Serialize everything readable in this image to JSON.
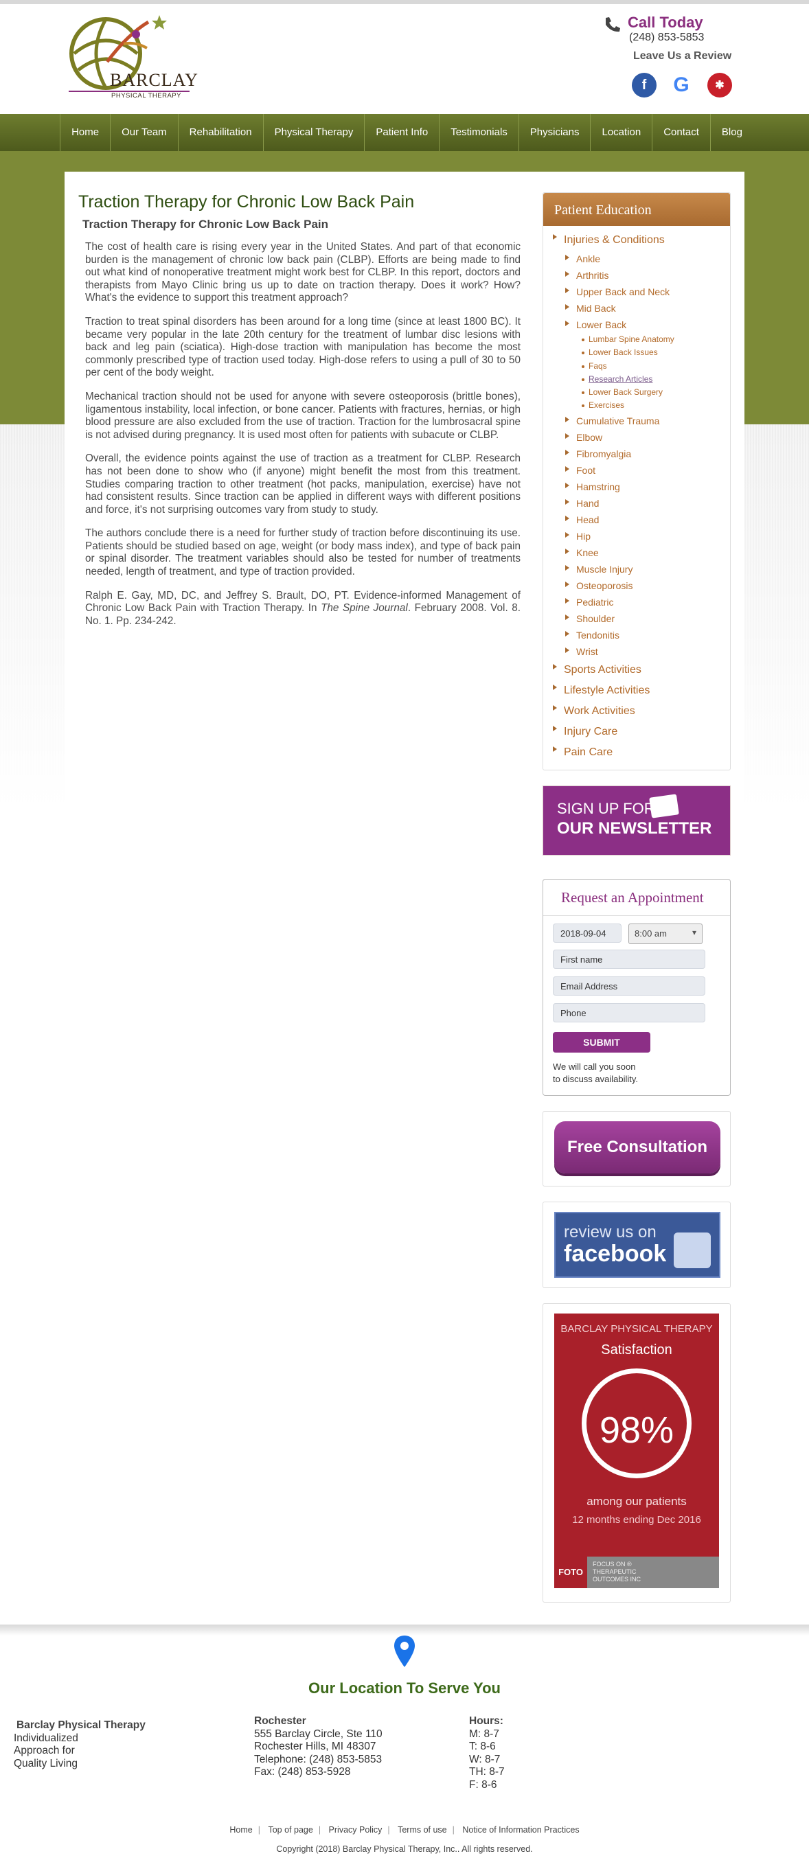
{
  "header": {
    "logo_name": "BARCLAY",
    "logo_sub": "PHYSICAL THERAPY",
    "call_title": "Call Today",
    "call_number": "(248) 853-5853",
    "review_text": "Leave Us a Review",
    "social_icons": [
      "facebook-icon",
      "google-icon",
      "yelp-icon"
    ]
  },
  "nav": [
    "Home",
    "Our Team",
    "Rehabilitation",
    "Physical Therapy",
    "Patient Info",
    "Testimonials",
    "Physicians",
    "Location",
    "Contact",
    "Blog"
  ],
  "article": {
    "title": "Traction Therapy for Chronic Low Back Pain",
    "subtitle": "Traction Therapy for Chronic Low Back Pain",
    "paragraphs": [
      "The cost of health care is rising every year in the United States. And part of that economic burden is the management of chronic low back pain (CLBP). Efforts are being made to find out what kind of nonoperative treatment might work best for CLBP. In this report, doctors and therapists from Mayo Clinic bring us up to date on traction therapy. Does it work? How? What's the evidence to support this treatment approach?",
      "Traction to treat spinal disorders has been around for a long time (since at least 1800 BC). It became very popular in the late 20th century for the treatment of lumbar disc lesions with back and leg pain (sciatica). High-dose traction with manipulation has become the most commonly prescribed type of traction used today. High-dose refers to using a pull of 30 to 50 per cent of the body weight.",
      "Mechanical traction should not be used for anyone with severe osteoporosis (brittle bones), ligamentous instability, local infection, or bone cancer. Patients with fractures, hernias, or high blood pressure are also excluded from the use of traction. Traction for the lumbrosacral spine is not advised during pregnancy. It is used most often for patients with subacute or CLBP.",
      "Overall, the evidence points against the use of traction as a treatment for CLBP. Research has not been done to show who (if anyone) might benefit the most from this treatment. Studies comparing traction to other treatment (hot packs, manipulation, exercise) have not had consistent results. Since traction can be applied in different ways with different positions and force, it's not surprising outcomes vary from study to study.",
      "The authors conclude there is a need for further study of traction before discontinuing its use. Patients should be studied based on age, weight (or body mass index), and type of back pain or spinal disorder. The treatment variables should also be tested for number of treatments needed, length of treatment, and type of traction provided."
    ],
    "citation_pre": "Ralph E. Gay, MD, DC, and Jeffrey S. Brault, DO, PT. Evidence-informed Management of Chronic Low Back Pain with Traction Therapy. In ",
    "citation_journal": "The Spine Journal",
    "citation_post": ". February 2008. Vol. 8. No. 1. Pp. 234-242."
  },
  "patient_education": {
    "heading": "Patient Education",
    "injuries": "Injuries & Conditions",
    "items_a": [
      "Ankle",
      "Arthritis",
      "Upper Back and Neck",
      "Mid Back"
    ],
    "lower_back": "Lower Back",
    "lower_back_sub": [
      "Lumbar Spine Anatomy",
      "Lower Back Issues",
      "Faqs",
      "Research Articles",
      "Lower Back Surgery",
      "Exercises"
    ],
    "items_b": [
      "Cumulative Trauma",
      "Elbow",
      "Fibromyalgia",
      "Foot",
      "Hamstring",
      "Hand",
      "Head",
      "Hip",
      "Knee",
      "Muscle Injury",
      "Osteoporosis",
      "Pediatric",
      "Shoulder",
      "Tendonitis",
      "Wrist"
    ],
    "top_items": [
      "Sports Activities",
      "Lifestyle Activities",
      "Work Activities",
      "Injury Care",
      "Pain Care"
    ]
  },
  "newsletter": {
    "line1": "SIGN UP FOR",
    "line2": "OUR NEWSLETTER"
  },
  "appointment": {
    "title": "Request an Appointment",
    "date": "2018-09-04",
    "time": "8:00 am",
    "first_name_ph": "First name",
    "email_ph": "Email Address",
    "phone_ph": "Phone",
    "submit": "SUBMIT",
    "note1": "We will call you soon",
    "note2": "to discuss availability."
  },
  "consultation": "Free Consultation",
  "facebook_review": {
    "line1": "review us on",
    "line2": "facebook"
  },
  "satisfaction": {
    "company": "BARCLAY PHYSICAL THERAPY",
    "label": "Satisfaction",
    "percent": "98%",
    "line1": "among our patients",
    "line2": "12 months ending Dec 2016",
    "foto": "FOTO",
    "foto_desc1": "FOCUS ON ®",
    "foto_desc2": "THERAPEUTIC",
    "foto_desc3": "OUTCOMES INC"
  },
  "footer": {
    "heading": "Our Location To Serve You",
    "company": "Barclay Physical Therapy",
    "tagline": [
      "Individualized",
      "Approach for",
      "Quality Living"
    ],
    "city": "Rochester",
    "address": [
      "555 Barclay Circle, Ste 110",
      "Rochester Hills, MI 48307",
      "Telephone: (248) 853-5853",
      "Fax: (248) 853-5928"
    ],
    "hours_title": "Hours:",
    "hours": [
      "M: 8-7",
      "T: 8-6",
      "W: 8-7",
      "TH: 8-7",
      "F: 8-6"
    ],
    "links": [
      "Home",
      "Top of page",
      "Privacy Policy",
      "Terms of use",
      "Notice of Information Practices"
    ],
    "copyright": "Copyright (2018) Barclay Physical Therapy, Inc.. All rights reserved."
  },
  "colors": {
    "brand_purple": "#8c2f86",
    "olive": "#7d8a37",
    "nav": "#5a6824",
    "accent_brown": "#b26a2a",
    "heading_green": "#2e4d10"
  }
}
